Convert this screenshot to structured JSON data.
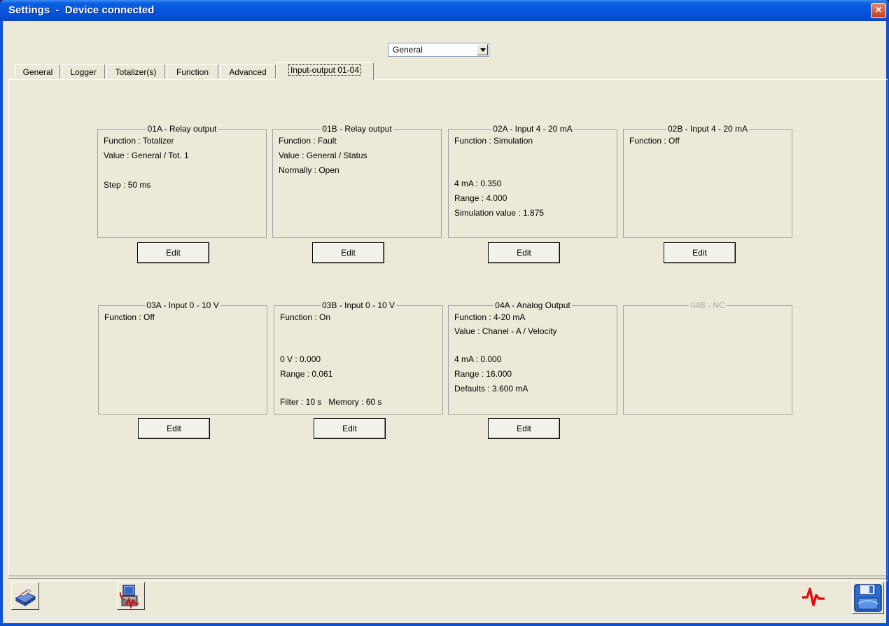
{
  "window": {
    "title": "Settings  -  Device connected",
    "close_glyph": "×"
  },
  "view_select": {
    "value": "General"
  },
  "tabs": [
    {
      "label": "General"
    },
    {
      "label": "Logger"
    },
    {
      "label": "Totalizer(s)"
    },
    {
      "label": "Function"
    },
    {
      "label": "Advanced"
    },
    {
      "label": "Input-output 01-04",
      "active": true
    }
  ],
  "groups": [
    {
      "title": "01A - Relay output",
      "lines": [
        "Function : Totalizer",
        "Value : General / Tot. 1",
        "",
        "Step : 50 ms"
      ],
      "edit_label": "Edit"
    },
    {
      "title": "01B - Relay output",
      "lines": [
        "Function : Fault",
        "Value : General / Status",
        "Normally : Open"
      ],
      "edit_label": "Edit"
    },
    {
      "title": "02A - Input 4 - 20 mA",
      "lines": [
        "Function : Simulation",
        "",
        "",
        "4 mA : 0.350",
        "Range : 4.000",
        "Simulation value : 1.875"
      ],
      "edit_label": "Edit"
    },
    {
      "title": "02B - Input 4 - 20 mA",
      "lines": [
        "Function : Off"
      ],
      "edit_label": "Edit"
    },
    {
      "title": "03A - Input 0 - 10 V",
      "lines": [
        "Function : Off"
      ],
      "edit_label": "Edit"
    },
    {
      "title": "03B - Input 0 - 10 V",
      "lines": [
        "Function : On",
        "",
        "",
        "0 V : 0.000",
        "Range : 0.061",
        "",
        "Filter : 10 s   Memory : 60 s"
      ],
      "edit_label": "Edit"
    },
    {
      "title": "04A - Analog Output",
      "lines": [
        "Function : 4-20 mA",
        "Value : Chanel - A / Velocity",
        "",
        "4 mA : 0.000",
        "Range : 16.000",
        "Defaults : 3.600 mA"
      ],
      "edit_label": "Edit"
    },
    {
      "title": "04B - NC",
      "lines": [],
      "disabled": true
    }
  ],
  "toolbar": {
    "print_icon": "printer-icon",
    "device_icon": "device-monitor-icon",
    "signal_icon": "signal-pulse-icon",
    "save_icon": "floppy-disk-icon"
  },
  "colors": {
    "title_bar": "#0a5fe0",
    "window_bg": "#ece9d8",
    "close_button": "#c43c1c",
    "pulse_red": "#e01010",
    "disabled_text": "#a8a8a8"
  }
}
